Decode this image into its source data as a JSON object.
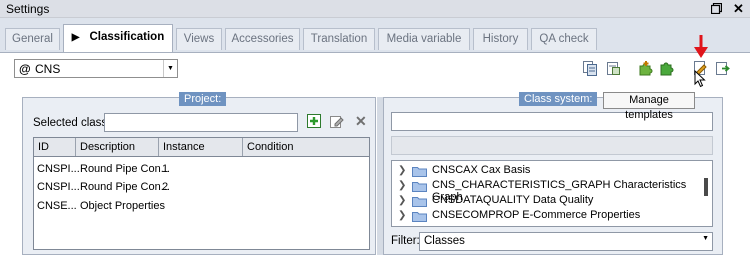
{
  "window": {
    "title": "Settings"
  },
  "tabs": [
    "General",
    "Classification",
    "Views",
    "Accessories",
    "Translation",
    "Media variable",
    "History",
    "QA check"
  ],
  "catalog": {
    "prefix": "@",
    "value": "CNS"
  },
  "project": {
    "title": "Project:",
    "selected_classes_label": "Selected classes",
    "columns": [
      "ID",
      "Description",
      "Instance",
      "Condition"
    ],
    "rows": [
      {
        "id": "CNSPI...",
        "description": "Round Pipe Con...",
        "instance": "1",
        "condition": ""
      },
      {
        "id": "CNSPI...",
        "description": "Round Pipe Con...",
        "instance": "2",
        "condition": ""
      },
      {
        "id": "CNSE...",
        "description": "Object Properties",
        "instance": "",
        "condition": ""
      }
    ]
  },
  "class_system": {
    "title": "Class system:",
    "items": [
      "CNSCAX Cax Basis",
      "CNS_CHARACTERISTICS_GRAPH Characteristics Graph",
      "CNSDATAQUALITY Data Quality",
      "CNSECOMPROP E-Commerce Properties"
    ],
    "filter_label": "Filter:",
    "filter_value": "Classes"
  },
  "tooltip": "Manage templates",
  "icons": {
    "toolbar": [
      "copy-icon",
      "paste-icon",
      "puzzle-add-icon",
      "puzzle-icon",
      "manage-templates-icon",
      "export-icon"
    ],
    "grid": [
      "add-icon",
      "edit-icon",
      "delete-icon"
    ]
  },
  "colors": {
    "accent": "#6f93c1",
    "arrow": "#e0151b",
    "panel_bg": "#eaeef4"
  }
}
